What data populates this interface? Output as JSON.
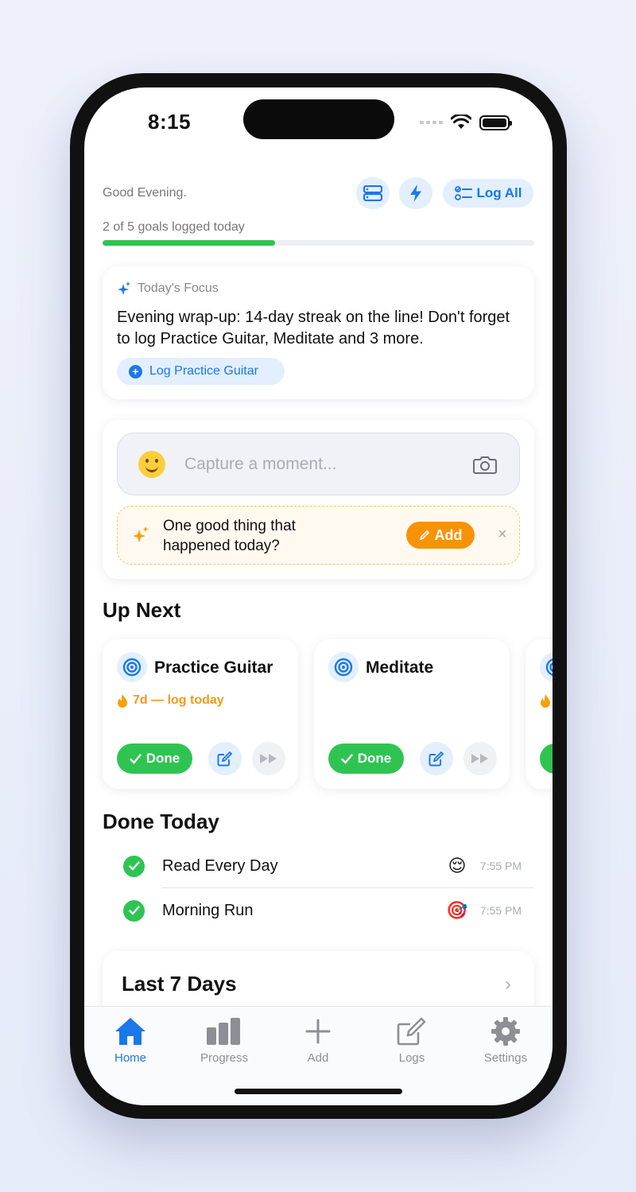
{
  "status_bar": {
    "time": "8:15"
  },
  "header": {
    "greeting": "Good Evening.",
    "log_all_label": "Log All",
    "progress_text": "2 of 5 goals logged today",
    "progress_fraction": 0.4
  },
  "focus": {
    "heading": "Today's Focus",
    "body": "Evening wrap-up: 14-day streak on the line! Don't forget to log Practice Guitar, Meditate and 3 more.",
    "button_label": "Log Practice Guitar"
  },
  "capture": {
    "placeholder": "Capture a moment...",
    "prompt_text": "One good thing that happened today?",
    "add_label": "Add",
    "close_glyph": "×"
  },
  "up_next": {
    "title": "Up Next",
    "goals": [
      {
        "name": "Practice Guitar",
        "streak": "7d — log today",
        "done_label": "Done"
      },
      {
        "name": "Meditate",
        "streak": "",
        "done_label": "Done"
      }
    ]
  },
  "done_today": {
    "title": "Done Today",
    "items": [
      {
        "name": "Read Every Day",
        "emoji": "😌",
        "time": "7:55 PM"
      },
      {
        "name": "Morning Run",
        "emoji": "🎯",
        "time": "7:55 PM"
      }
    ]
  },
  "last7": {
    "title": "Last 7 Days",
    "chevron": "›"
  },
  "tabs": [
    {
      "label": "Home",
      "icon": "home-icon"
    },
    {
      "label": "Progress",
      "icon": "bar-chart-icon"
    },
    {
      "label": "Add",
      "icon": "plus-icon"
    },
    {
      "label": "Logs",
      "icon": "compose-icon"
    },
    {
      "label": "Settings",
      "icon": "gear-icon"
    }
  ],
  "colors": {
    "accent": "#1a78e8",
    "success": "#2fc452",
    "warning": "#f79308"
  }
}
